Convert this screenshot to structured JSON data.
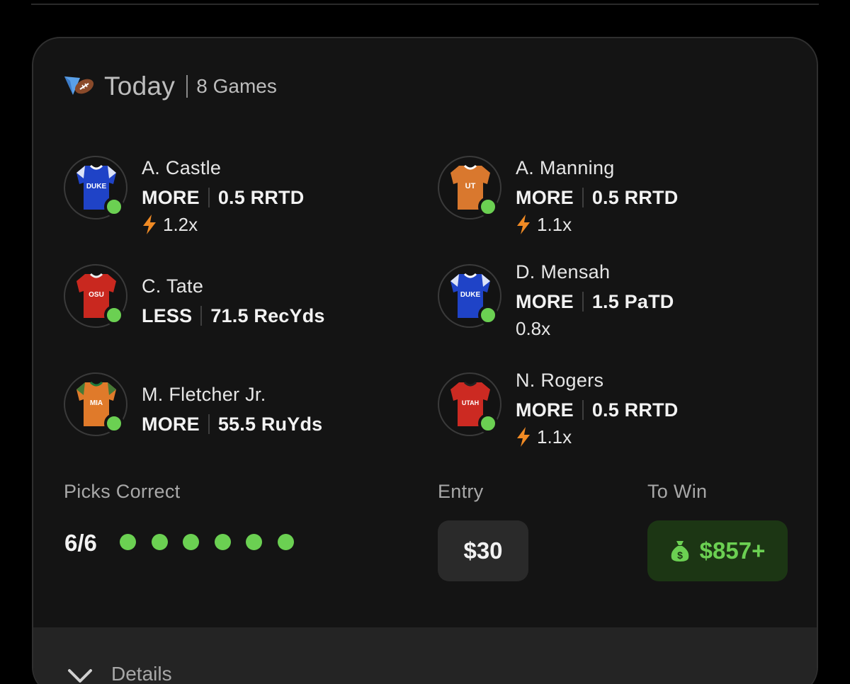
{
  "header": {
    "title": "Today",
    "games": "8 Games",
    "sport_icon": "football-icon"
  },
  "picks": [
    {
      "name": "A. Castle",
      "direction": "MORE",
      "stat": "0.5 RRTD",
      "multiplier": "1.2x",
      "boosted": true,
      "team": "DUKE",
      "jersey_color": "#1f43c7",
      "status": "correct"
    },
    {
      "name": "A. Manning",
      "direction": "MORE",
      "stat": "0.5 RRTD",
      "multiplier": "1.1x",
      "boosted": true,
      "team": "UT",
      "jersey_color": "#d9782e",
      "status": "correct"
    },
    {
      "name": "C. Tate",
      "direction": "LESS",
      "stat": "71.5 RecYds",
      "multiplier": "",
      "boosted": false,
      "team": "OSU",
      "jersey_color": "#c9281f",
      "status": "correct"
    },
    {
      "name": "D. Mensah",
      "direction": "MORE",
      "stat": "1.5 PaTD",
      "multiplier": "0.8x",
      "boosted": false,
      "team": "DUKE",
      "jersey_color": "#1f43c7",
      "status": "correct"
    },
    {
      "name": "M. Fletcher Jr.",
      "direction": "MORE",
      "stat": "55.5 RuYds",
      "multiplier": "",
      "boosted": false,
      "team": "MIA",
      "jersey_color": "#e07a2a",
      "status": "correct"
    },
    {
      "name": "N. Rogers",
      "direction": "MORE",
      "stat": "0.5 RRTD",
      "multiplier": "1.1x",
      "boosted": true,
      "team": "UTAH",
      "jersey_color": "#cc2a22",
      "status": "correct"
    }
  ],
  "summary": {
    "picks_label": "Picks Correct",
    "picks_value": "6/6",
    "entry_label": "Entry",
    "entry_value": "$30",
    "win_label": "To Win",
    "win_value": "$857+"
  },
  "details": {
    "label": "Details"
  },
  "colors": {
    "accent_green": "#6bd052",
    "boost_orange": "#f08a24",
    "card_bg": "#141414"
  }
}
